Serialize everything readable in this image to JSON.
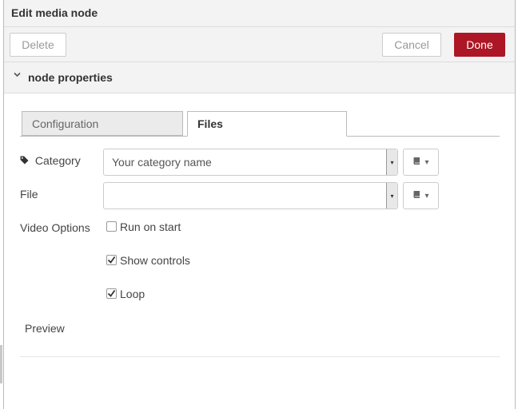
{
  "dialog": {
    "title": "Edit media node"
  },
  "toolbar": {
    "delete_label": "Delete",
    "cancel_label": "Cancel",
    "done_label": "Done"
  },
  "section": {
    "label": "node properties"
  },
  "tabs": [
    {
      "label": "Configuration",
      "active": false
    },
    {
      "label": "Files",
      "active": true
    }
  ],
  "form": {
    "category": {
      "label": "Category",
      "value": "Your category name"
    },
    "file": {
      "label": "File",
      "value": ""
    },
    "video_options": {
      "label": "Video Options",
      "options": [
        {
          "label": "Run on start",
          "checked": false
        },
        {
          "label": "Show controls",
          "checked": true
        },
        {
          "label": "Loop",
          "checked": true
        }
      ]
    },
    "preview": {
      "label": "Preview"
    }
  },
  "colors": {
    "done_button": "#ad1625",
    "header_bg": "#f3f3f3"
  },
  "icons": {
    "section_toggle": "chevron-down-icon",
    "category": "tag-icon",
    "side_button": "book-icon"
  }
}
